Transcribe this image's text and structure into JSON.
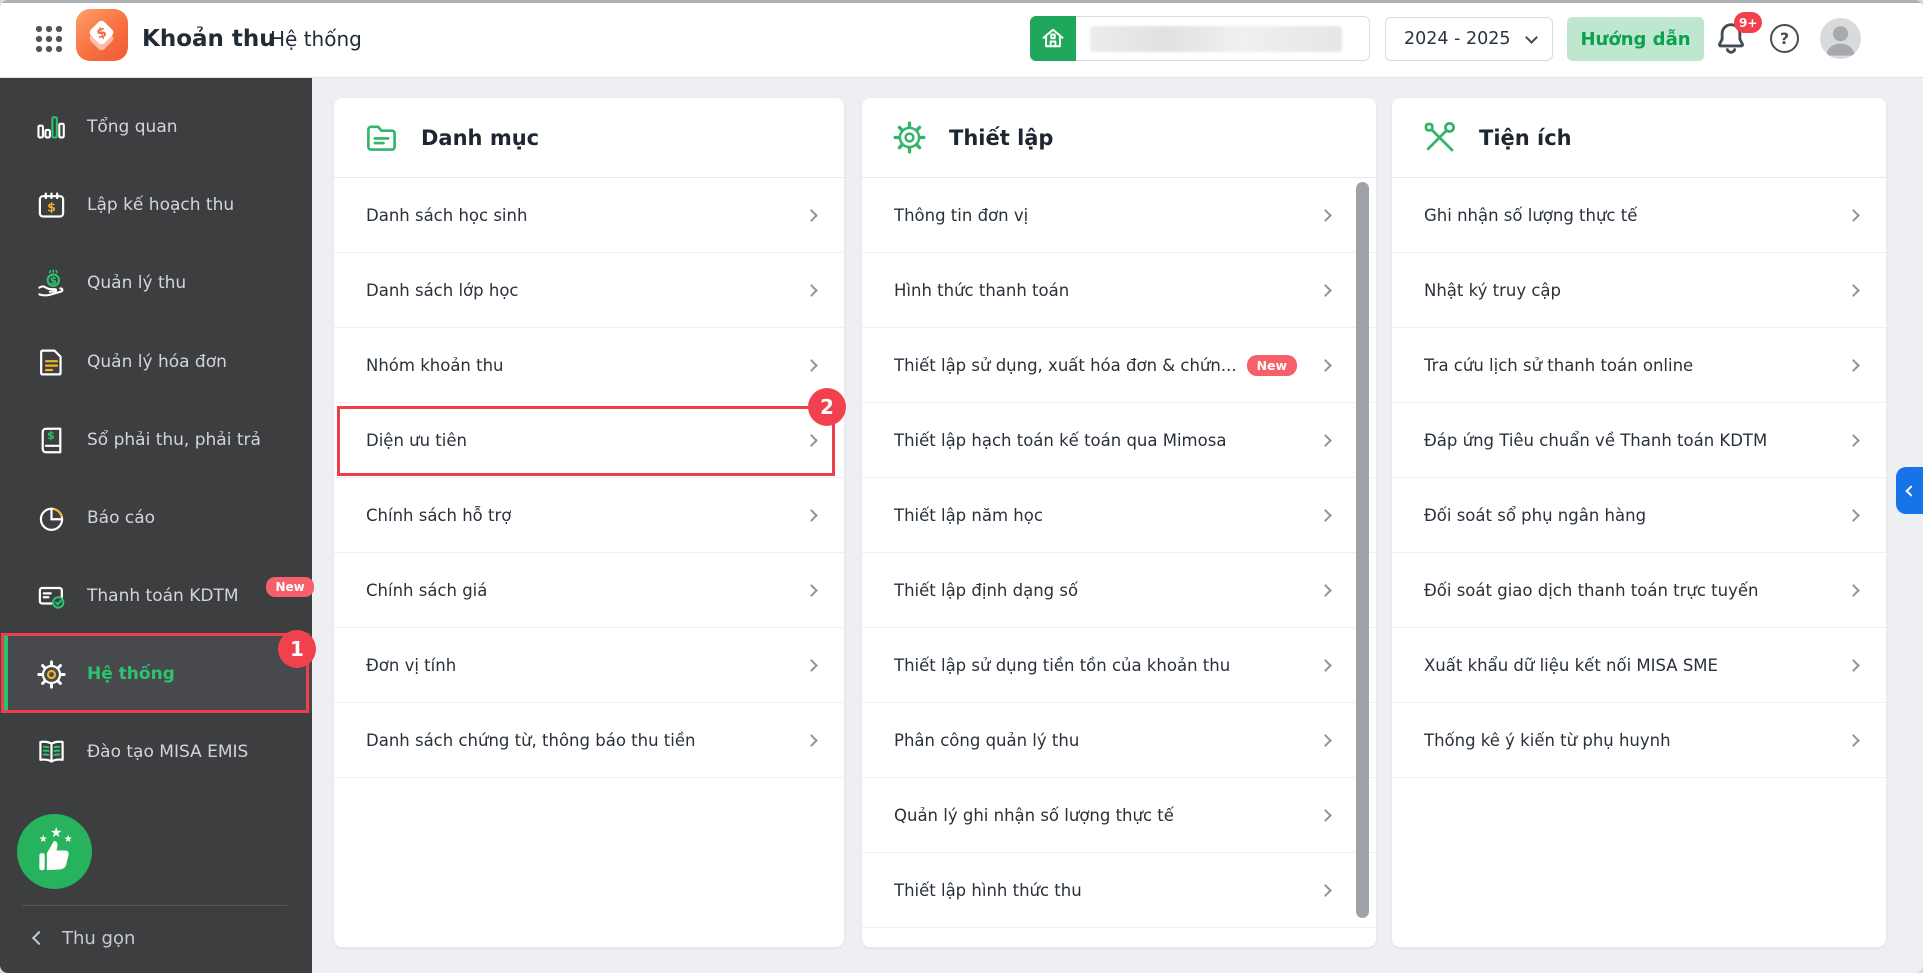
{
  "header": {
    "app_title": "Khoản thu",
    "breadcrumb": "Hệ thống",
    "school_year": "2024 - 2025",
    "guide_label": "Hướng dẫn",
    "notification_count": "9+",
    "help_glyph": "?"
  },
  "sidebar": {
    "items": [
      {
        "label": "Tổng quan",
        "icon": "bar-chart-icon"
      },
      {
        "label": "Lập kế hoạch thu",
        "icon": "calendar-dollar-icon"
      },
      {
        "label": "Quản lý thu",
        "icon": "hand-coin-icon"
      },
      {
        "label": "Quản lý hóa đơn",
        "icon": "invoice-icon"
      },
      {
        "label": "Sổ phải thu, phải trả",
        "icon": "ledger-book-icon"
      },
      {
        "label": "Báo cáo",
        "icon": "pie-chart-icon"
      },
      {
        "label": "Thanh toán KDTM",
        "icon": "payment-card-check-icon",
        "badge": "New"
      },
      {
        "label": "Hệ thống",
        "icon": "gear-icon",
        "active": true
      },
      {
        "label": "Đào tạo MISA EMIS",
        "icon": "open-book-icon"
      }
    ],
    "collapse_label": "Thu gọn"
  },
  "columns": [
    {
      "title": "Danh mục",
      "icon": "folder-icon",
      "items": [
        {
          "label": "Danh sách học sinh"
        },
        {
          "label": "Danh sách lớp học"
        },
        {
          "label": "Nhóm khoản thu"
        },
        {
          "label": "Diện ưu tiên",
          "highlighted": true
        },
        {
          "label": "Chính sách hỗ trợ"
        },
        {
          "label": "Chính sách giá"
        },
        {
          "label": "Đơn vị tính"
        },
        {
          "label": "Danh sách chứng từ, thông báo thu tiền"
        }
      ]
    },
    {
      "title": "Thiết lập",
      "icon": "gear-icon",
      "items": [
        {
          "label": "Thông tin đơn vị"
        },
        {
          "label": "Hình thức thanh toán"
        },
        {
          "label": "Thiết lập sử dụng, xuất hóa đơn & chứn...",
          "badge": "New"
        },
        {
          "label": "Thiết lập hạch toán kế toán qua Mimosa"
        },
        {
          "label": "Thiết lập năm học"
        },
        {
          "label": "Thiết lập định dạng số"
        },
        {
          "label": "Thiết lập sử dụng tiền tồn của khoản thu"
        },
        {
          "label": "Phân công quản lý thu"
        },
        {
          "label": "Quản lý ghi nhận số lượng thực tế"
        },
        {
          "label": "Thiết lập hình thức thu"
        }
      ]
    },
    {
      "title": "Tiện ích",
      "icon": "tools-icon",
      "items": [
        {
          "label": "Ghi nhận số lượng thực tế"
        },
        {
          "label": "Nhật ký truy cập"
        },
        {
          "label": "Tra cứu lịch sử thanh toán online"
        },
        {
          "label": "Đáp ứng Tiêu chuẩn về Thanh toán KDTM"
        },
        {
          "label": "Đối soát sổ phụ ngân hàng"
        },
        {
          "label": "Đối soát giao dịch thanh toán trực tuyến"
        },
        {
          "label": "Xuất khẩu dữ liệu kết nối MISA SME"
        },
        {
          "label": "Thống kê ý kiến từ phụ huynh"
        }
      ]
    }
  ],
  "annotations": {
    "steps": [
      {
        "number": "1"
      },
      {
        "number": "2"
      }
    ]
  },
  "colors": {
    "brand_green": "#2cc36f",
    "annotation_red": "#ee3e4b",
    "badge_red": "#f75f6b",
    "home_green": "#1fa85c",
    "guide_bg": "#bfe7cf",
    "guide_text": "#0aa14f",
    "handle_blue": "#1673e8",
    "sidebar_bg": "#3d3e40",
    "content_bg": "#edeff3"
  }
}
